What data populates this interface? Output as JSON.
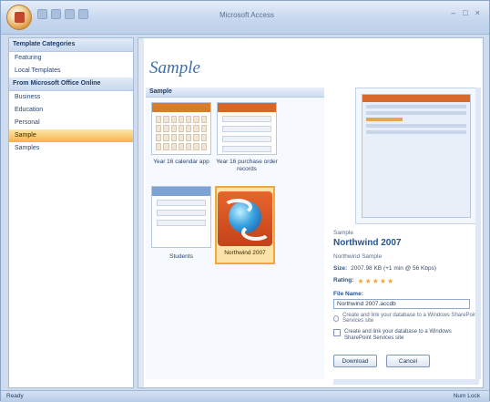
{
  "window": {
    "title": "Microsoft Access"
  },
  "sidebar": {
    "header": "Template Categories",
    "items": [
      {
        "label": "Featuring"
      },
      {
        "label": "Local Templates"
      }
    ],
    "section_header": "From Microsoft Office Online",
    "online_items": [
      {
        "label": "Business"
      },
      {
        "label": "Education"
      },
      {
        "label": "Personal"
      },
      {
        "label": "Sample",
        "active": true
      },
      {
        "label": "Samples"
      }
    ]
  },
  "main": {
    "title": "Sample",
    "panel_header": "Sample",
    "templates": [
      {
        "label": "Year 16 calendar app"
      },
      {
        "label": "Year 16 purchase order records"
      },
      {
        "label": "Students"
      },
      {
        "label": "Northwind 2007"
      }
    ]
  },
  "detail": {
    "provider": "Sample",
    "title": "Northwind 2007",
    "subtitle": "Northwind Sample",
    "size_label": "Size:",
    "size_value": "2007.98 KB (+1 min @ 56 Kbps)",
    "rating_label": "Rating:",
    "rating_stars": "★★★★★",
    "file_name_label": "File Name:",
    "file_name_value": "Northwind 2007.accdb",
    "link_option": "Create and link your database to a Windows SharePoint Services site",
    "sharepoint_option": "Create and link your database to a Windows SharePoint Services site",
    "download_button": "Download",
    "cancel_button": "Cancel"
  },
  "status": {
    "left": "Ready",
    "right": "Num Lock"
  }
}
